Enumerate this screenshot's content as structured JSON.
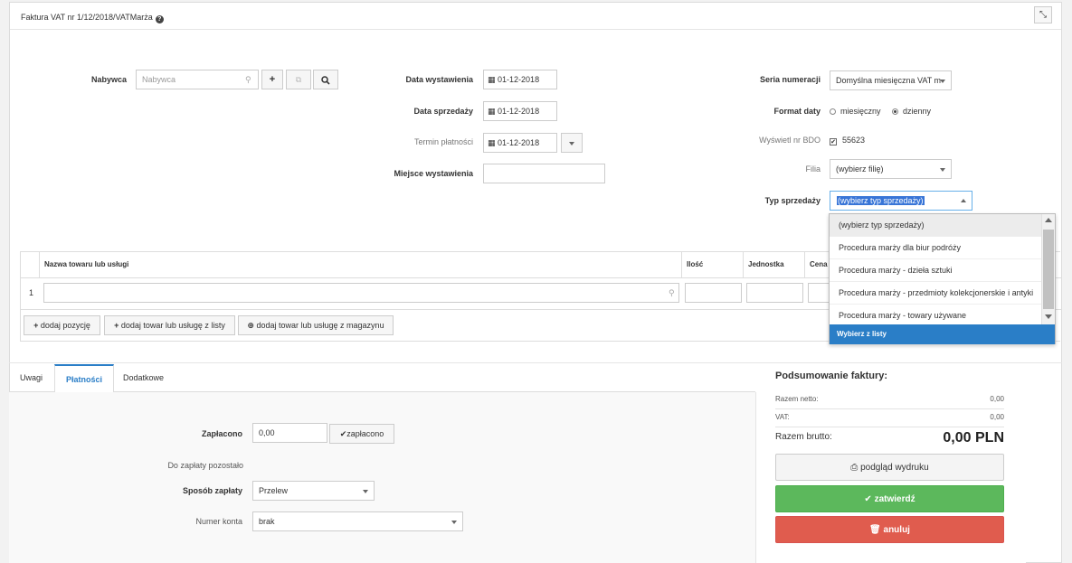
{
  "window": {
    "title": "Faktura VAT nr 1/12/2018/VATMarża",
    "help_icon": "question-circle-icon",
    "expand_icon": "expand-icon"
  },
  "form": {
    "buyer": {
      "label": "Nabywca",
      "placeholder": "Nabywca",
      "add_label": "+",
      "search_label": "search"
    },
    "issue_date": {
      "label": "Data wystawienia",
      "value": "01-12-2018"
    },
    "sale_date": {
      "label": "Data sprzedaży",
      "value": "01-12-2018"
    },
    "payment_due": {
      "label": "Termin płatności",
      "value": "01-12-2018"
    },
    "issue_place": {
      "label": "Miejsce wystawienia",
      "value": ""
    },
    "numbering_series": {
      "label": "Seria numeracji",
      "value": "Domyślna miesięczna VAT m"
    },
    "date_format": {
      "label": "Format daty",
      "options": [
        "miesięczny",
        "dzienny"
      ],
      "selected": "dzienny"
    },
    "bdo": {
      "label": "Wyświetl nr BDO",
      "checked": true,
      "value": "55623"
    },
    "branch": {
      "label": "Filia",
      "value": "(wybierz filię)"
    },
    "sale_type": {
      "label": "Typ sprzedaży",
      "value": "(wybierz typ sprzedaży)",
      "options": [
        "(wybierz typ sprzedaży)",
        "Procedura marży dla biur podróży",
        "Procedura marży - dzieła sztuki",
        "Procedura marży - przedmioty kolekcjonerskie i antyki",
        "Procedura marży - towary używane"
      ],
      "footer": "Wybierz z listy"
    }
  },
  "items_table": {
    "columns": [
      "Nazwa towaru lub usługi",
      "Ilość",
      "Jednostka",
      "Cena n"
    ],
    "rows": [
      {
        "num": "1",
        "name": "",
        "qty": "",
        "unit": "",
        "price": ""
      }
    ],
    "buttons": {
      "add_position": "dodaj pozycję",
      "add_from_list": "dodaj towar lub usługę z listy",
      "add_from_warehouse": "dodaj towar lub usługę z magazynu"
    }
  },
  "tabs": [
    {
      "label": "Uwagi"
    },
    {
      "label": "Płatności",
      "active": true
    },
    {
      "label": "Dodatkowe"
    }
  ],
  "payments": {
    "paid": {
      "label": "Zapłacono",
      "value": "0,00",
      "button": "zapłacono"
    },
    "remaining_label": "Do zapłaty pozostało",
    "method": {
      "label": "Sposób zapłaty",
      "value": "Przelew"
    },
    "account": {
      "label": "Numer konta",
      "value": "brak"
    }
  },
  "summary": {
    "title": "Podsumowanie faktury:",
    "net": {
      "label": "Razem netto:",
      "value": "0,00"
    },
    "vat": {
      "label": "VAT:",
      "value": "0,00"
    },
    "gross": {
      "label": "Razem brutto:",
      "value": "0,00 PLN"
    },
    "preview_button": "podgląd wydruku",
    "confirm_button": "zatwierdź",
    "cancel_button": "anuluj"
  },
  "colors": {
    "primary": "#2a7ec7",
    "success": "#5cb85c",
    "danger": "#e05c4e"
  }
}
